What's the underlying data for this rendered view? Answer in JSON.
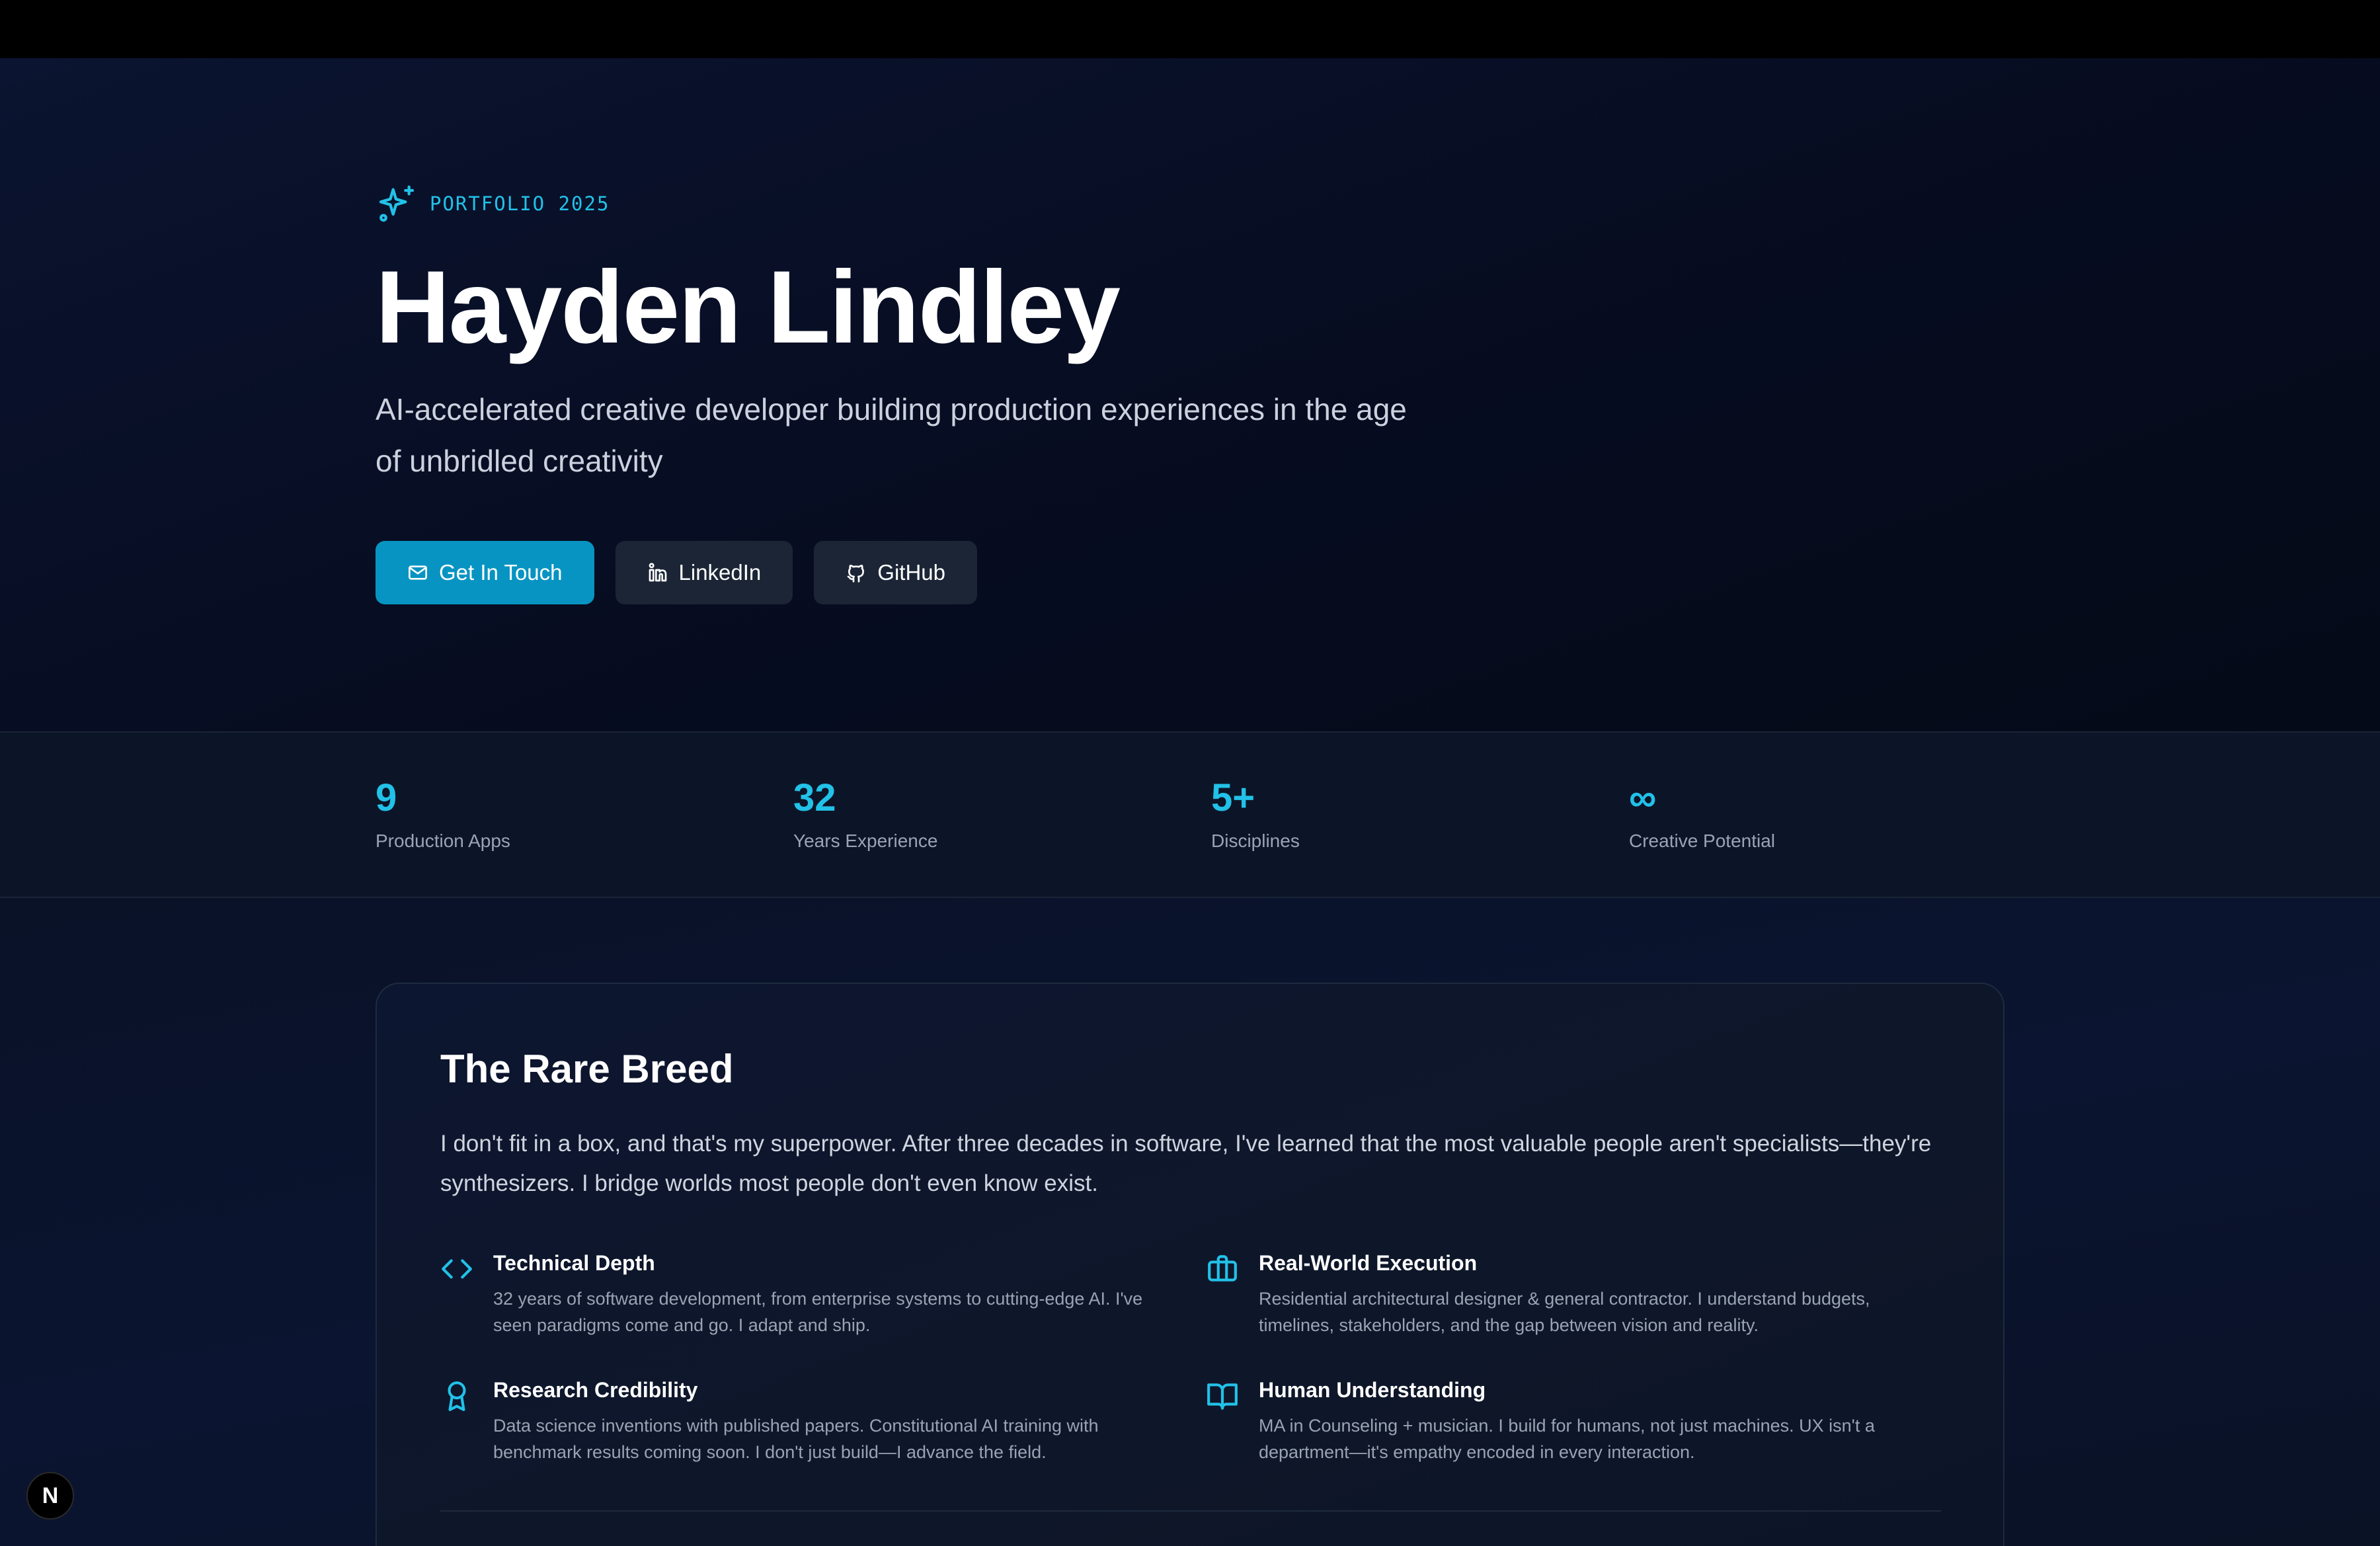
{
  "hero": {
    "tag": "PORTFOLIO 2025",
    "name": "Hayden Lindley",
    "subtitle": "AI-accelerated creative developer building production experiences in the age of unbridled creativity",
    "buttons": {
      "contact": "Get In Touch",
      "linkedin": "LinkedIn",
      "github": "GitHub"
    }
  },
  "stats": [
    {
      "value": "9",
      "label": "Production Apps"
    },
    {
      "value": "32",
      "label": "Years Experience"
    },
    {
      "value": "5+",
      "label": "Disciplines"
    },
    {
      "value": "∞",
      "label": "Creative Potential"
    }
  ],
  "about": {
    "title": "The Rare Breed",
    "intro": "I don't fit in a box, and that's my superpower. After three decades in software, I've learned that the most valuable people aren't specialists—they're synthesizers. I bridge worlds most people don't even know exist.",
    "features": [
      {
        "icon": "code-icon",
        "title": "Technical Depth",
        "desc": "32 years of software development, from enterprise systems to cutting-edge AI. I've seen paradigms come and go. I adapt and ship."
      },
      {
        "icon": "briefcase-icon",
        "title": "Real-World Execution",
        "desc": "Residential architectural designer & general contractor. I understand budgets, timelines, stakeholders, and the gap between vision and reality."
      },
      {
        "icon": "award-icon",
        "title": "Research Credibility",
        "desc": "Data science inventions with published papers. Constitutional AI training with benchmark results coming soon. I don't just build—I advance the field."
      },
      {
        "icon": "book-open-icon",
        "title": "Human Understanding",
        "desc": "MA in Counseling + musician. I build for humans, not just machines. UX isn't a department—it's empathy encoded in every interaction."
      }
    ]
  },
  "badge": {
    "letter": "N"
  },
  "colors": {
    "accent": "#22c1e8",
    "primary_button": "#0894c2",
    "background": "#070c1c"
  }
}
